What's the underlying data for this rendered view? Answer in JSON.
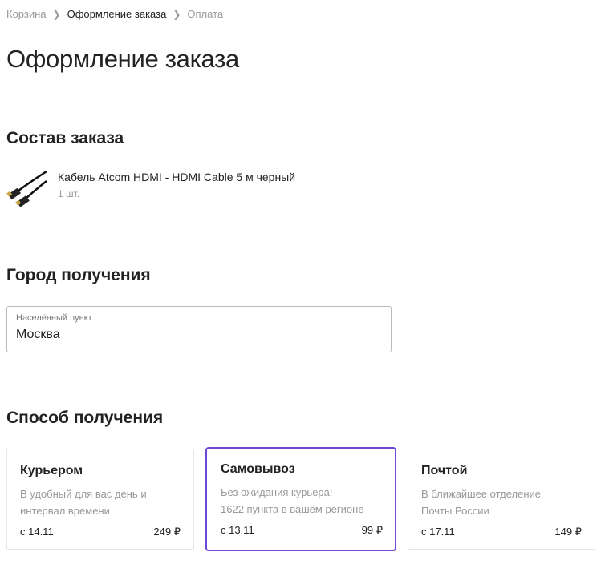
{
  "breadcrumbs": [
    "Корзина",
    "Оформление заказа",
    "Оплата"
  ],
  "title": "Оформление заказа",
  "order": {
    "heading": "Состав заказа",
    "item": {
      "name": "Кабель Atcom HDMI - HDMI Cable 5 м черный",
      "qty": "1 шт."
    }
  },
  "city": {
    "heading": "Город получения",
    "label": "Населённый пункт",
    "value": "Москва"
  },
  "delivery": {
    "heading": "Способ получения",
    "selected_color": "#6e47d6",
    "options": [
      {
        "title": "Курьером",
        "desc1": "В удобный для вас день и",
        "desc2": "интервал времени",
        "date": "с 14.11",
        "price": "249 ₽"
      },
      {
        "title": "Самовывоз",
        "desc1": "Без ожидания курьера!",
        "desc2": "1622 пункта в вашем регионе",
        "date": "с 13.11",
        "price": "99 ₽"
      },
      {
        "title": "Почтой",
        "desc1": "В ближайшее отделение",
        "desc2": "Почты России",
        "date": "с 17.11",
        "price": "149 ₽"
      }
    ]
  }
}
